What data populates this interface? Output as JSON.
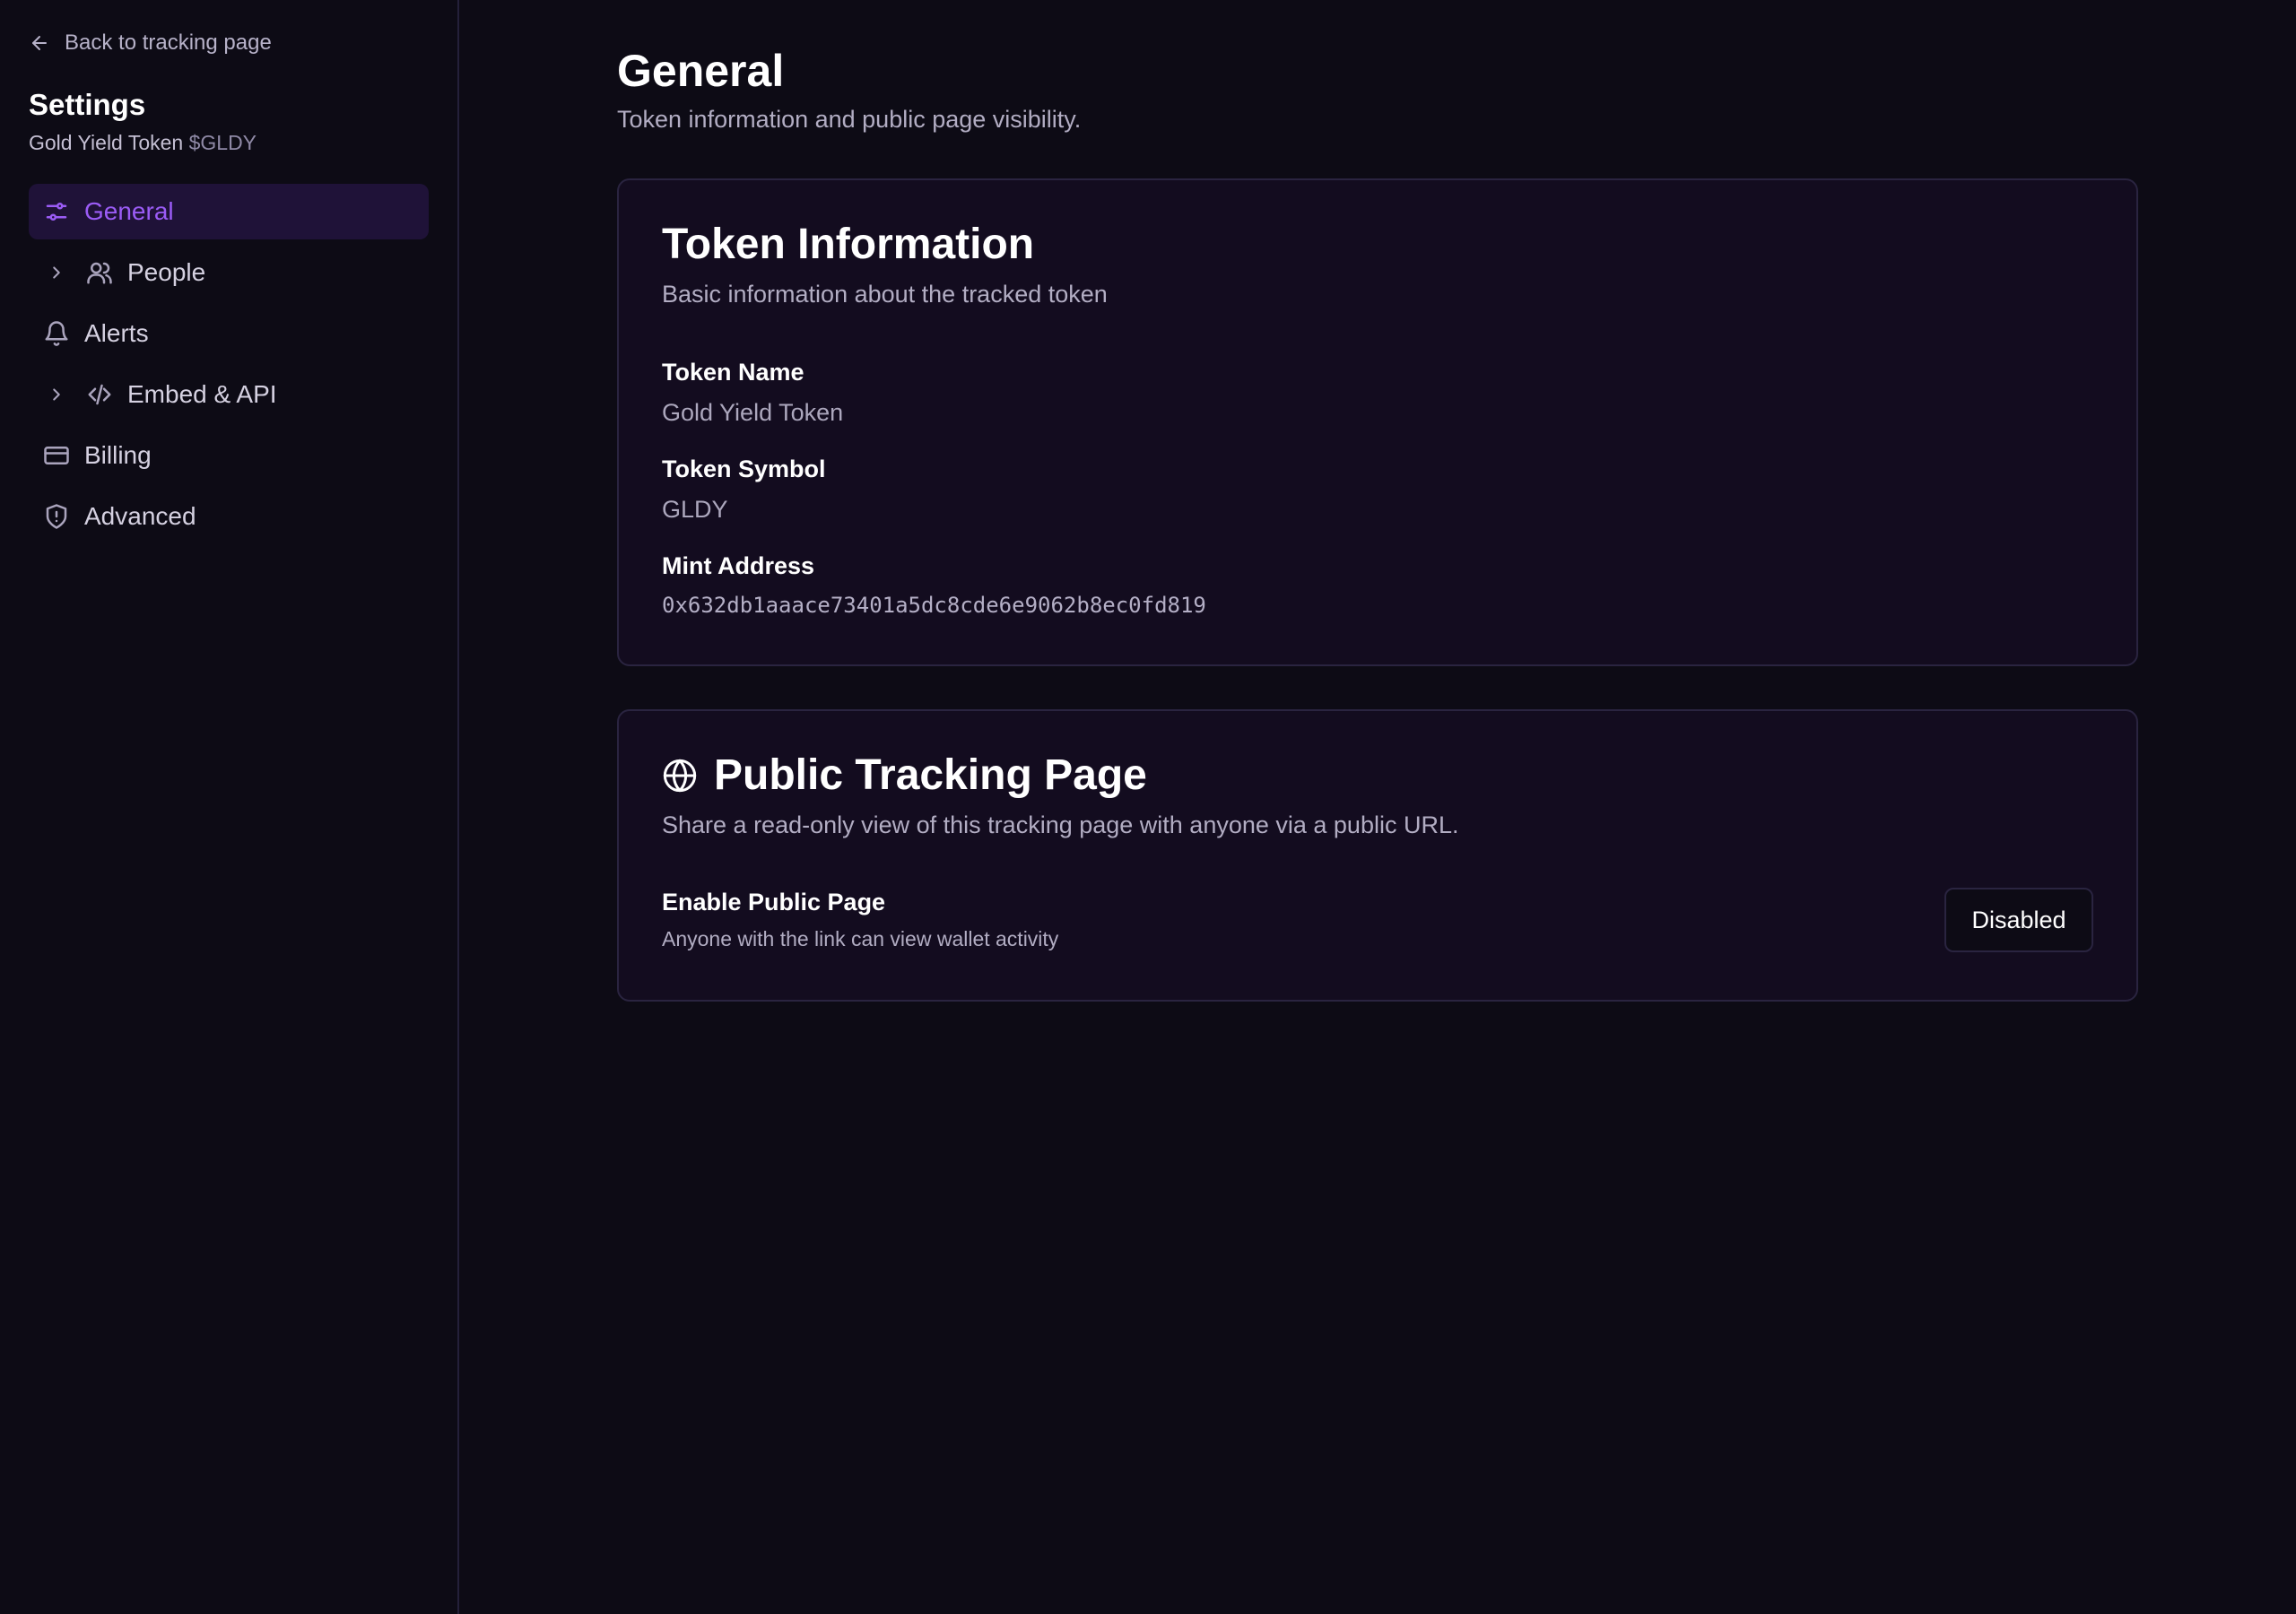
{
  "sidebar": {
    "back_label": "Back to tracking page",
    "title": "Settings",
    "token_name": "Gold Yield Token",
    "token_symbol": "$GLDY",
    "items": [
      {
        "label": "General",
        "icon": "sliders-icon",
        "active": true,
        "expandable": false
      },
      {
        "label": "People",
        "icon": "users-icon",
        "active": false,
        "expandable": true
      },
      {
        "label": "Alerts",
        "icon": "bell-icon",
        "active": false,
        "expandable": false
      },
      {
        "label": "Embed & API",
        "icon": "code-icon",
        "active": false,
        "expandable": true
      },
      {
        "label": "Billing",
        "icon": "credit-card-icon",
        "active": false,
        "expandable": false
      },
      {
        "label": "Advanced",
        "icon": "shield-alert-icon",
        "active": false,
        "expandable": false
      }
    ]
  },
  "main": {
    "title": "General",
    "subtitle": "Token information and public page visibility.",
    "token_card": {
      "title": "Token Information",
      "description": "Basic information about the tracked token",
      "fields": [
        {
          "label": "Token Name",
          "value": "Gold Yield Token"
        },
        {
          "label": "Token Symbol",
          "value": "GLDY"
        },
        {
          "label": "Mint Address",
          "value": "0x632db1aaace73401a5dc8cde6e9062b8ec0fd819"
        }
      ]
    },
    "public_card": {
      "title": "Public Tracking Page",
      "icon": "globe-icon",
      "description": "Share a read-only view of this tracking page with anyone via a public URL.",
      "toggle_label": "Enable Public Page",
      "toggle_hint": "Anyone with the link can view wallet activity",
      "button_label": "Disabled"
    }
  },
  "colors": {
    "background": "#0d0b15",
    "card": "#130c1f",
    "accent": "#9b5cf6",
    "active_bg": "#1f1238"
  }
}
